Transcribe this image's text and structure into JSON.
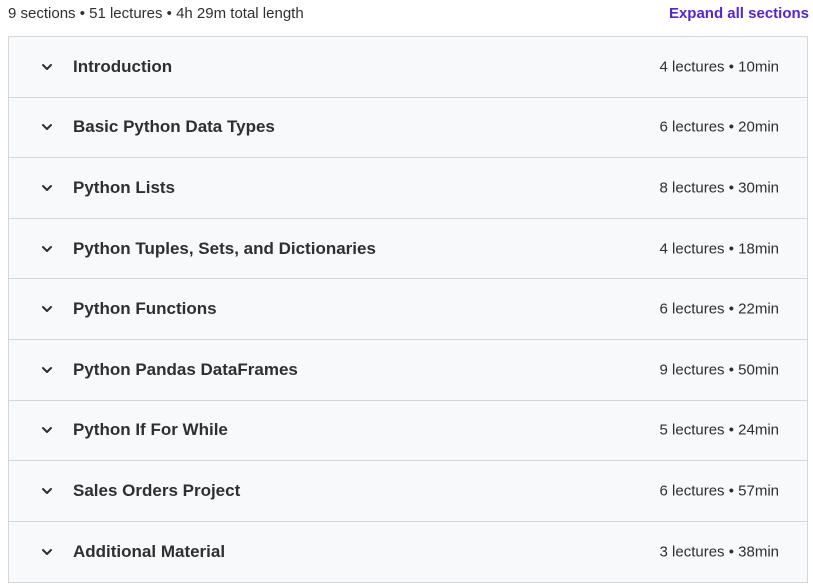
{
  "header": {
    "summary": "9 sections • 51 lectures • 4h 29m total length",
    "expand_label": "Expand all sections"
  },
  "colors": {
    "link": "#5624d0",
    "row_bg": "#f7f9fa",
    "border": "#d1d7dc",
    "text": "#2d2f31"
  },
  "sections": [
    {
      "title": "Introduction",
      "meta": "4 lectures • 10min",
      "icon": "chevron-down-icon"
    },
    {
      "title": "Basic Python Data Types",
      "meta": "6 lectures • 20min",
      "icon": "chevron-down-icon"
    },
    {
      "title": "Python Lists",
      "meta": "8 lectures • 30min",
      "icon": "chevron-down-icon"
    },
    {
      "title": "Python Tuples, Sets, and Dictionaries",
      "meta": "4 lectures • 18min",
      "icon": "chevron-down-icon"
    },
    {
      "title": "Python Functions",
      "meta": "6 lectures • 22min",
      "icon": "chevron-down-icon"
    },
    {
      "title": "Python Pandas DataFrames",
      "meta": "9 lectures • 50min",
      "icon": "chevron-down-icon"
    },
    {
      "title": "Python If For While",
      "meta": "5 lectures • 24min",
      "icon": "chevron-down-icon"
    },
    {
      "title": "Sales Orders Project",
      "meta": "6 lectures • 57min",
      "icon": "chevron-down-icon"
    },
    {
      "title": "Additional Material",
      "meta": "3 lectures • 38min",
      "icon": "chevron-down-icon"
    }
  ]
}
